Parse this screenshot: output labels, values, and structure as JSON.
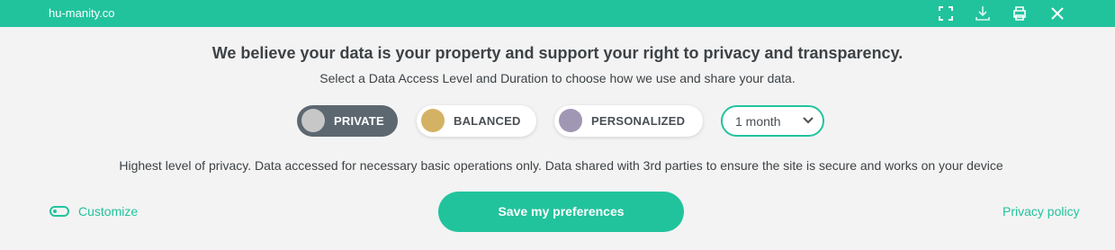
{
  "header": {
    "site": "hu-manity.co",
    "icons": [
      "fullscreen-icon",
      "download-icon",
      "print-icon",
      "close-icon"
    ]
  },
  "headline": "We believe your data is your property and support your right to privacy and transparency.",
  "subline": "Select a Data Access Level and Duration to choose how we use and share your data.",
  "levels": [
    {
      "label": "PRIVATE",
      "dot_color": "#c7c7c7",
      "selected": true
    },
    {
      "label": "BALANCED",
      "dot_color": "#d4b263",
      "selected": false
    },
    {
      "label": "PERSONALIZED",
      "dot_color": "#9f97b3",
      "selected": false
    }
  ],
  "duration": {
    "value": "1 month"
  },
  "description": "Highest level of privacy. Data accessed for necessary basic operations only. Data shared with 3rd parties to ensure the site is secure and works on your device",
  "footer": {
    "customize_label": "Customize",
    "save_label": "Save my preferences",
    "privacy_label": "Privacy policy"
  },
  "colors": {
    "accent": "#21c39d",
    "selected_bg": "#5d6770",
    "background": "#f3f3f3"
  }
}
